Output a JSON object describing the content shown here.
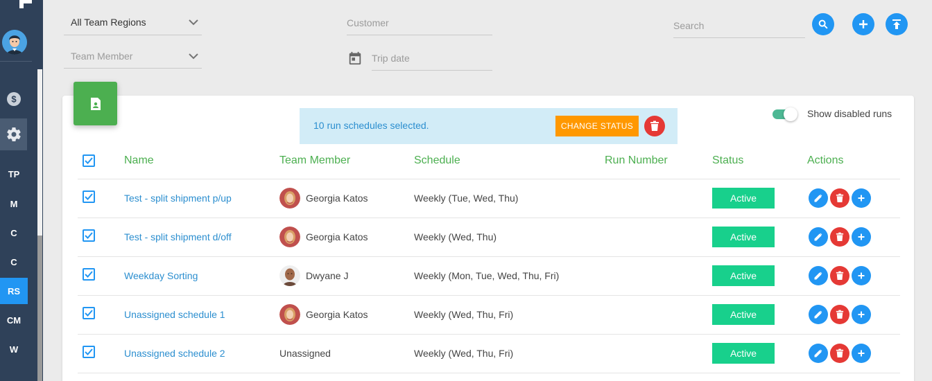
{
  "sidebar": {
    "items": [
      {
        "label": "TP"
      },
      {
        "label": "M"
      },
      {
        "label": "C"
      },
      {
        "label": "C"
      },
      {
        "label": "RS",
        "active": true
      },
      {
        "label": "CM"
      },
      {
        "label": "W"
      }
    ]
  },
  "filters": {
    "region": "All Team Regions",
    "team_member_placeholder": "Team Member",
    "customer_placeholder": "Customer",
    "trip_date_placeholder": "Trip date",
    "search_placeholder": "Search"
  },
  "selection": {
    "message": "10 run schedules selected.",
    "change_status_label": "CHANGE STATUS"
  },
  "toggle": {
    "label": "Show disabled runs",
    "on": true
  },
  "table": {
    "headers": {
      "name": "Name",
      "team_member": "Team Member",
      "schedule": "Schedule",
      "run_number": "Run Number",
      "status": "Status",
      "actions": "Actions"
    },
    "rows": [
      {
        "name": "Test - split shipment p/up",
        "member": "Georgia Katos",
        "avatar": "female",
        "schedule": "Weekly (Tue, Wed, Thu)",
        "run_number": "",
        "status": "Active"
      },
      {
        "name": "Test - split shipment d/off",
        "member": "Georgia Katos",
        "avatar": "female",
        "schedule": "Weekly (Wed, Thu)",
        "run_number": "",
        "status": "Active"
      },
      {
        "name": "Weekday Sorting",
        "member": "Dwyane J",
        "avatar": "male",
        "schedule": "Weekly (Mon, Tue, Wed, Thu, Fri)",
        "run_number": "",
        "status": "Active"
      },
      {
        "name": "Unassigned schedule 1",
        "member": "Georgia Katos",
        "avatar": "female",
        "schedule": "Weekly (Wed, Thu, Fri)",
        "run_number": "",
        "status": "Active"
      },
      {
        "name": "Unassigned schedule 2",
        "member": "Unassigned",
        "avatar": "",
        "schedule": "Weekly (Wed, Thu, Fri)",
        "run_number": "",
        "status": "Active"
      }
    ]
  },
  "colors": {
    "sidebar": "#2f4159",
    "accent": "#2196f3",
    "header_green": "#4caf50",
    "status_active": "#18d08c",
    "danger": "#e53935",
    "warning": "#ff9800"
  }
}
